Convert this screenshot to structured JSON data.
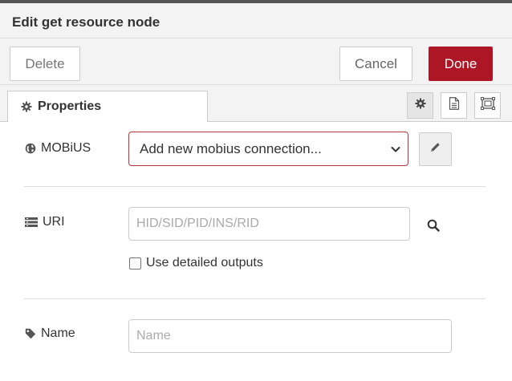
{
  "dialog": {
    "title": "Edit get resource node"
  },
  "toolbar": {
    "delete_label": "Delete",
    "cancel_label": "Cancel",
    "done_label": "Done",
    "done_color": "#ad1625"
  },
  "tabs": {
    "properties_label": "Properties",
    "icons": [
      "gear-icon",
      "description-icon",
      "appearance-icon"
    ]
  },
  "form": {
    "mobius": {
      "label": "MOBiUS",
      "selected": "Add new mobius connection...",
      "icon": "globe-icon"
    },
    "uri": {
      "label": "URI",
      "placeholder": "HID/SID/PID/INS/RID",
      "value": "",
      "icon": "list-icon"
    },
    "detailed_outputs": {
      "label": "Use detailed outputs",
      "checked": false
    },
    "name": {
      "label": "Name",
      "placeholder": "Name",
      "value": "",
      "icon": "tag-icon"
    }
  }
}
